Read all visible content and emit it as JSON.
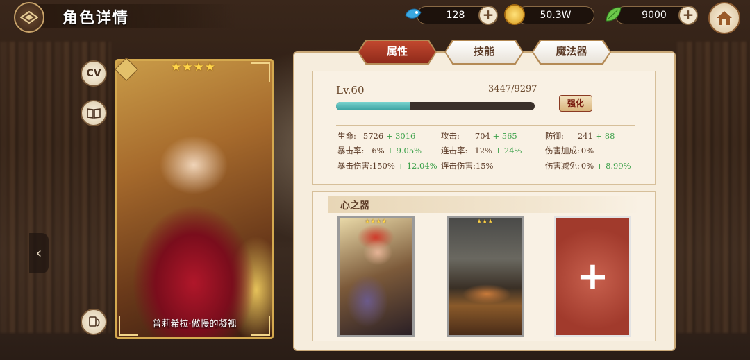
{
  "header": {
    "title": "角色详情",
    "currencies": [
      {
        "name": "gems",
        "icon": "blue-fish-icon",
        "value": "128"
      },
      {
        "name": "gold",
        "icon": "gold-coin-icon",
        "value": "50.3W"
      },
      {
        "name": "stamina",
        "icon": "green-leaf-icon",
        "value": "9000"
      }
    ]
  },
  "side": {
    "cv_label": "CV",
    "book_icon": "book-icon",
    "swap_icon": "swap-icon"
  },
  "card": {
    "stars": "★★★★",
    "name": "普莉希拉·傲慢的凝视"
  },
  "tabs": [
    {
      "label": "属性",
      "active": true
    },
    {
      "label": "技能",
      "active": false
    },
    {
      "label": "魔法器",
      "active": false
    }
  ],
  "level": {
    "label": "Lv.60",
    "exp_text": "3447/9297",
    "exp_fraction": 0.3708,
    "enhance_label": "强化"
  },
  "stats": [
    {
      "label": "生命:",
      "base": "5726",
      "bonus": "+ 3016"
    },
    {
      "label": "攻击:",
      "base": "704",
      "bonus": "+ 565"
    },
    {
      "label": "防御:",
      "base": "241",
      "bonus": "+ 88"
    },
    {
      "label": "暴击率:",
      "base": "6%",
      "bonus": "+ 9.05%"
    },
    {
      "label": "连击率:",
      "base": "12%",
      "bonus": "+ 24%"
    },
    {
      "label": "伤害加成:",
      "base": "0%",
      "bonus": ""
    },
    {
      "label": "暴击伤害:",
      "base": "150%",
      "bonus": "+ 12.04%"
    },
    {
      "label": "连击伤害:",
      "base": "15%",
      "bonus": ""
    },
    {
      "label": "伤害减免:",
      "base": "0%",
      "bonus": "+ 8.99%"
    }
  ],
  "heart": {
    "title": "心之器",
    "slots": [
      {
        "stars": "★★★★",
        "filled": true
      },
      {
        "stars": "★★★",
        "filled": true
      },
      {
        "stars": "",
        "filled": false,
        "add_label": "+"
      }
    ]
  }
}
